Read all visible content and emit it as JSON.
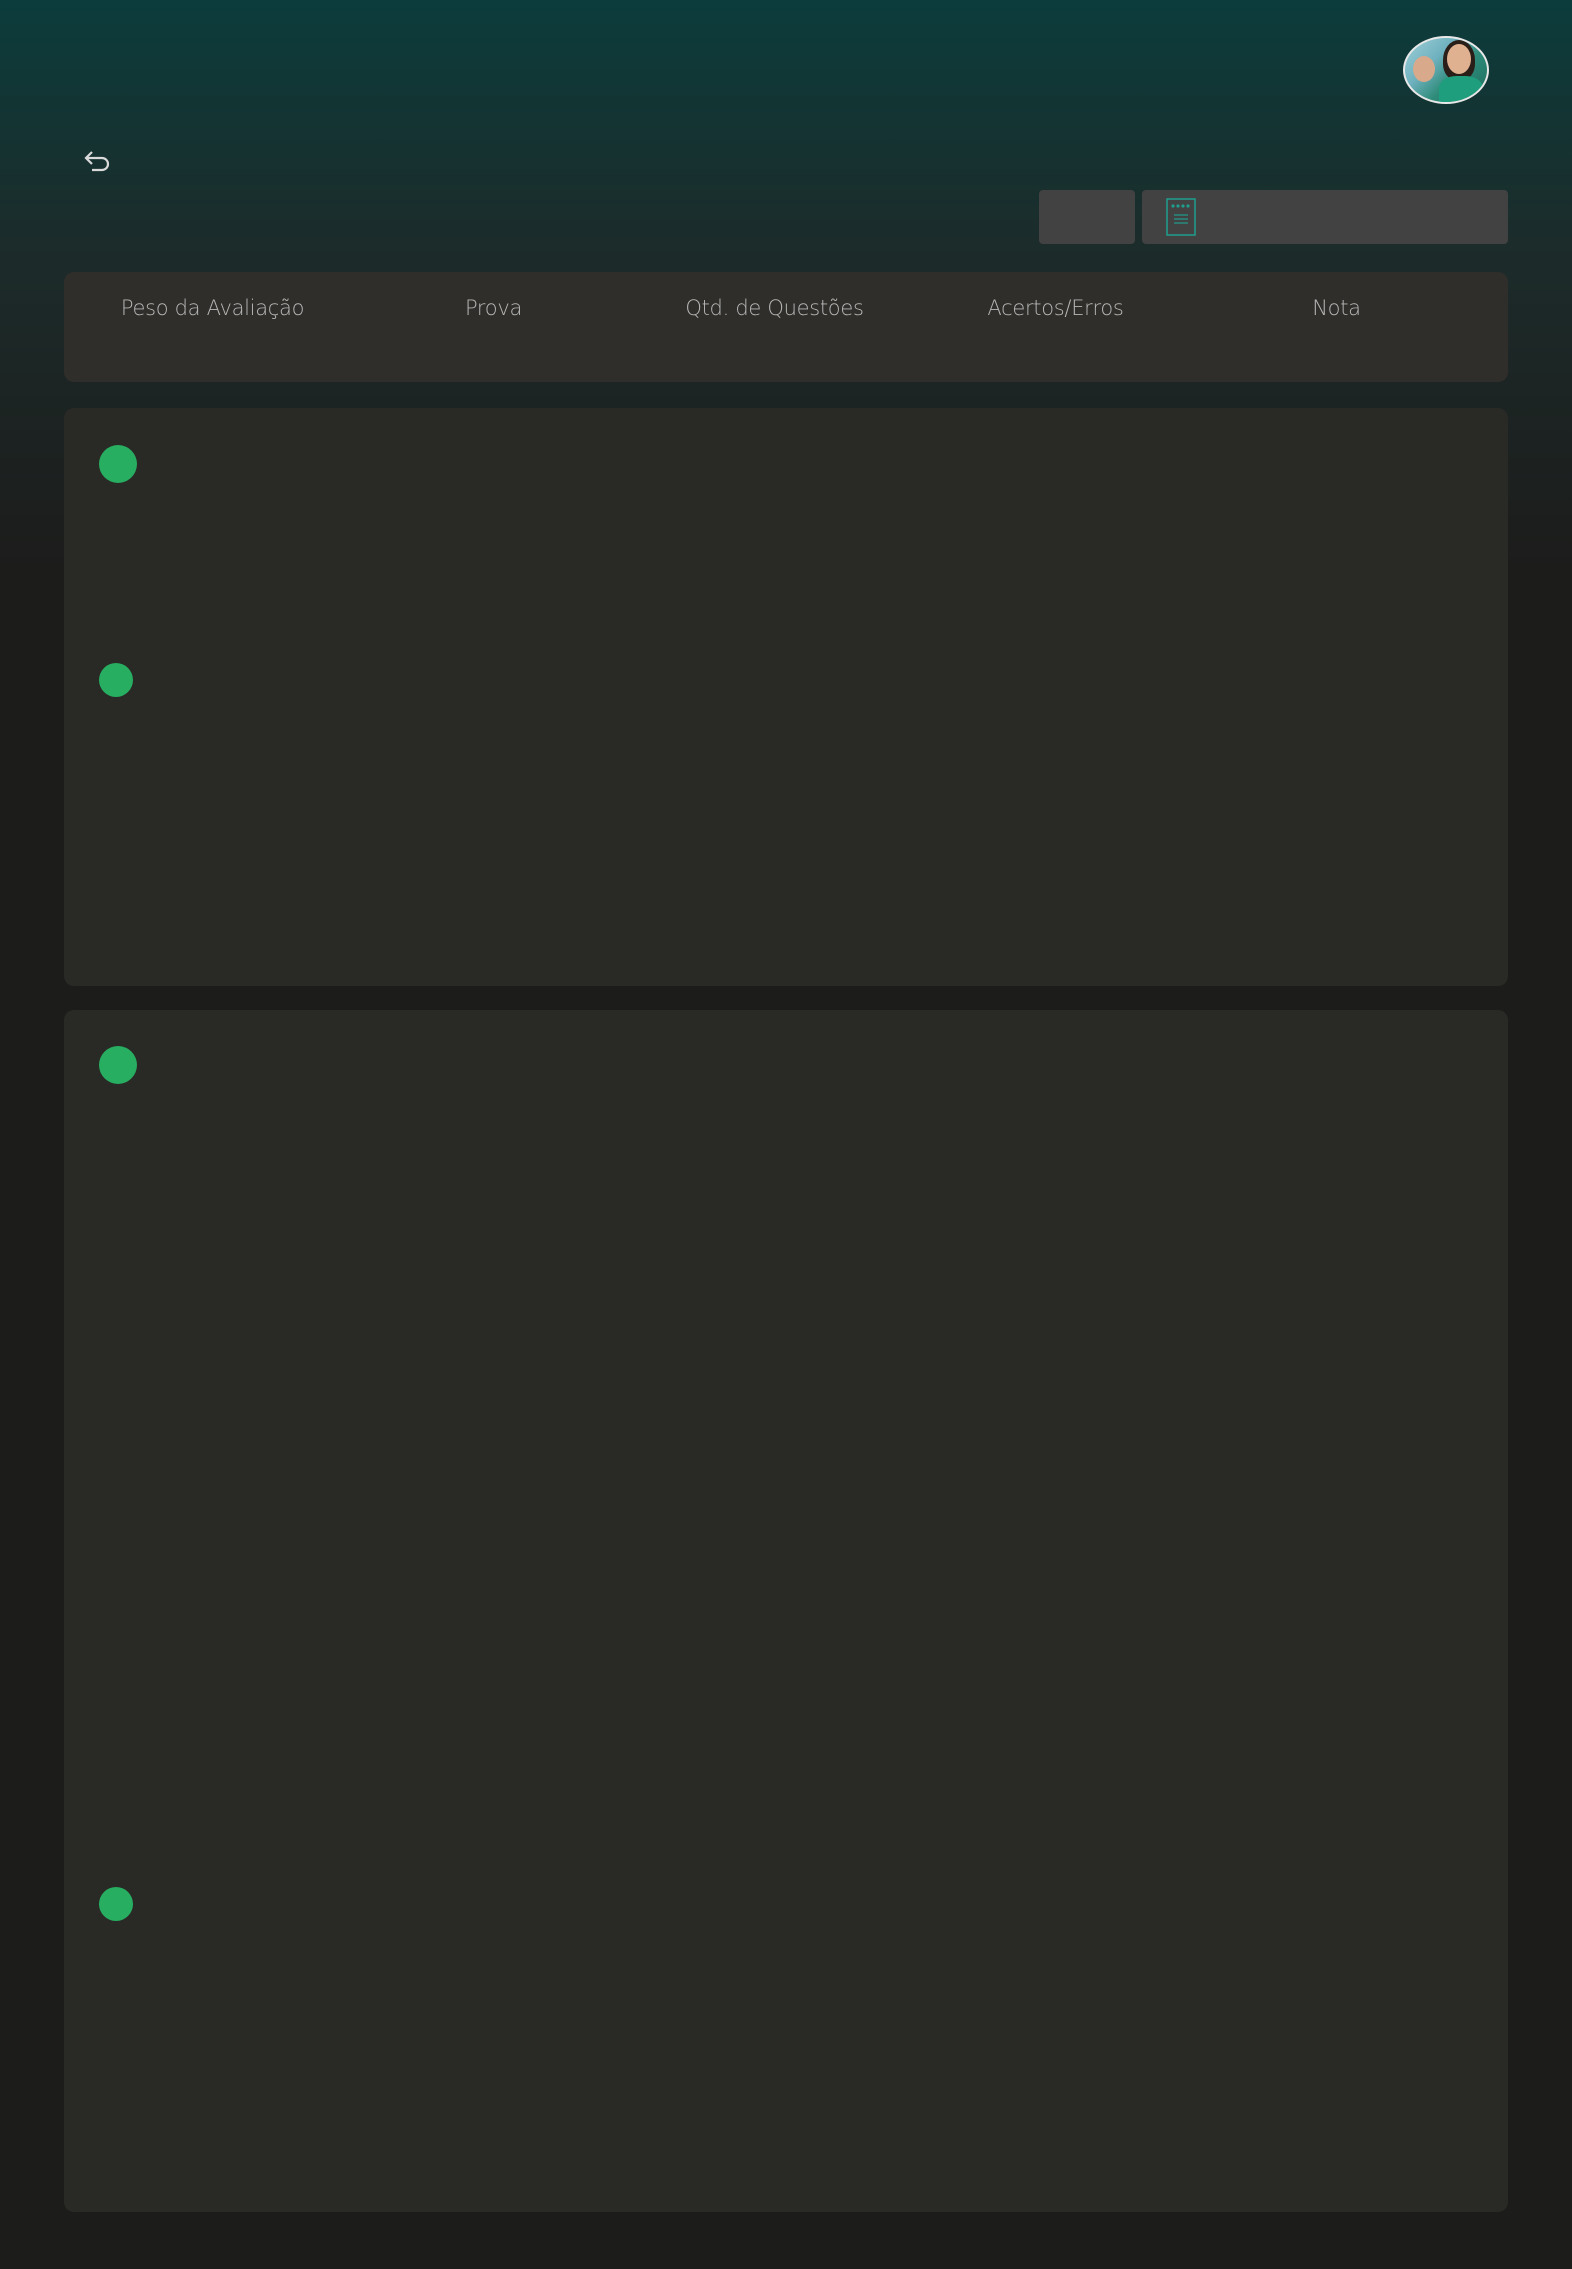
{
  "header": {
    "avatar_icon": "user-avatar",
    "back_icon": "return-arrow-icon",
    "document_icon": "document-icon",
    "accent_color": "#27ae60",
    "teal_color": "#0c3c3c"
  },
  "table": {
    "columns": [
      "Peso da Avaliação",
      "Prova",
      "Qtd. de Questões",
      "Acertos/Erros",
      "Nota"
    ]
  },
  "cards": [
    {
      "status_color": "#27ae60",
      "markers": 2
    },
    {
      "status_color": "#27ae60",
      "markers": 2
    }
  ]
}
